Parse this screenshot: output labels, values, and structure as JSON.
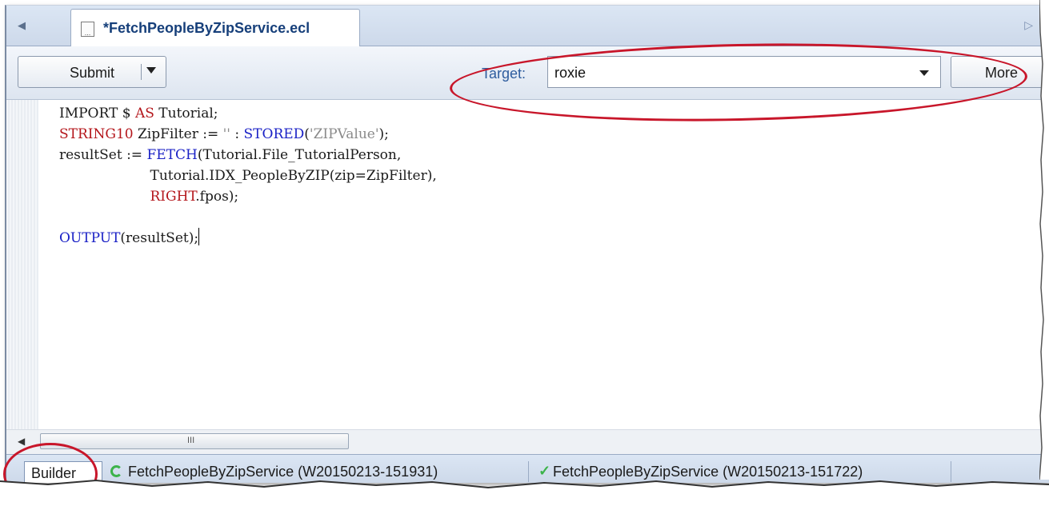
{
  "tab": {
    "title": "*FetchPeopleByZipService.ecl",
    "file_icon": "file-icon"
  },
  "toolbar": {
    "submit_label": "Submit",
    "target_label": "Target:",
    "target_value": "roxie",
    "more_label": "More"
  },
  "code": {
    "l1_a": "IMPORT $ ",
    "l1_b": "AS",
    "l1_c": " Tutorial;",
    "l2_a": "STRING10",
    "l2_b": " ZipFilter := ",
    "l2_c": "''",
    "l2_d": " : ",
    "l2_e": "STORED",
    "l2_f": "(",
    "l2_g": "'ZIPValue'",
    "l2_h": ");",
    "l3_a": "resultSet := ",
    "l3_b": "FETCH",
    "l3_c": "(Tutorial.File_TutorialPerson,",
    "l4": "                     Tutorial.IDX_PeopleByZIP(zip=ZipFilter),",
    "l5_a": "                     ",
    "l5_b": "RIGHT",
    "l5_c": ".fpos);",
    "l7_a": "OUTPUT",
    "l7_b": "(resultSet);"
  },
  "scrollbar": {
    "grip": "III"
  },
  "status": {
    "builder_label": "Builder",
    "workunit_1": "FetchPeopleByZipService (W20150213-151931)",
    "workunit_2": "FetchPeopleByZipService (W20150213-151722)",
    "workunit_1_state": "running",
    "workunit_2_state": "completed"
  },
  "colors": {
    "keyword_red": "#b4161b",
    "keyword_blue": "#1b22c6",
    "annotation_red": "#c8162a",
    "status_green": "#3cb34a"
  }
}
